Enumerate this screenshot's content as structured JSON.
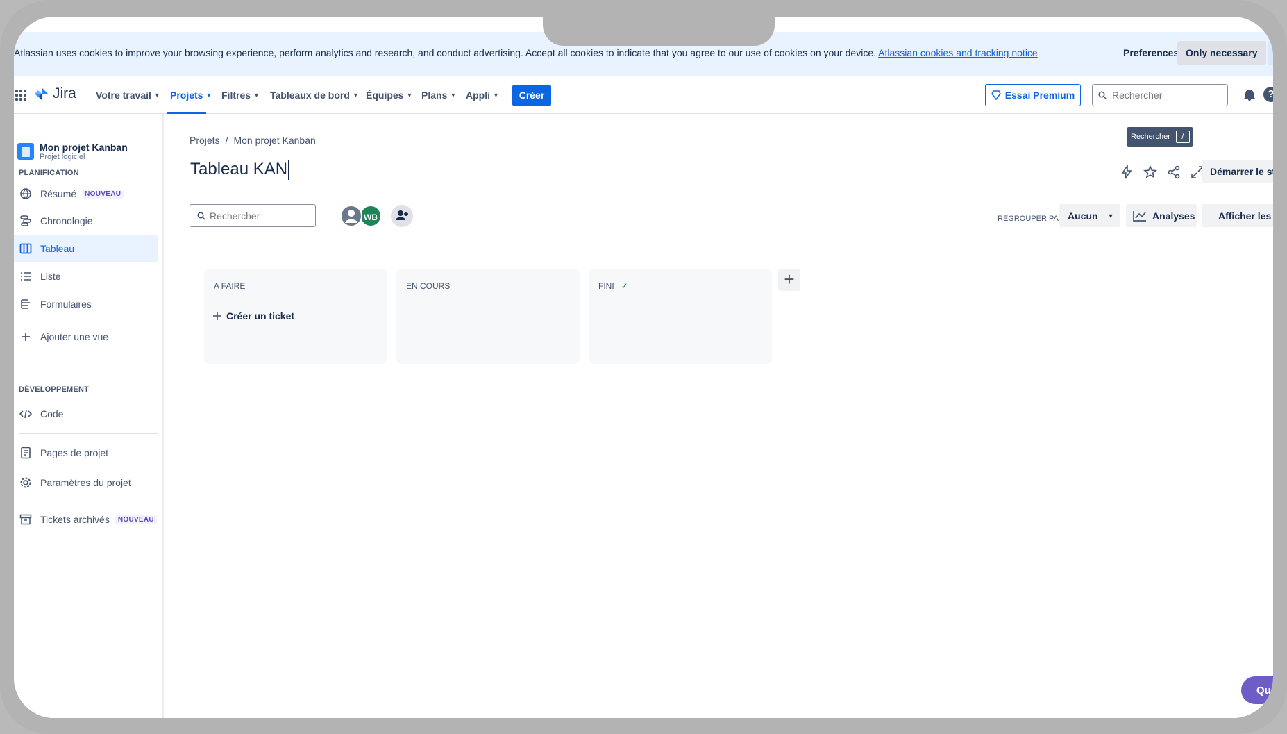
{
  "cookie_banner": {
    "message": "Atlassian uses cookies to improve your browsing experience, perform analytics and research, and conduct advertising. Accept all cookies to indicate that you agree to our use of cookies on your device.",
    "link": "Atlassian cookies and tracking notice",
    "preferences": "Preferences",
    "only_necessary": "Only necessary"
  },
  "topnav": {
    "logo": "Jira",
    "items": [
      "Votre travail",
      "Projets",
      "Filtres",
      "Tableaux de bord",
      "Équipes",
      "Plans",
      "Appli"
    ],
    "active_item": "Projets",
    "create": "Créer",
    "premium": "Essai Premium",
    "search_placeholder": "Rechercher",
    "tooltip": "Rechercher",
    "tooltip_key": "/"
  },
  "sidebar": {
    "project_name": "Mon projet Kanban",
    "project_type": "Projet logiciel",
    "planning_title": "PLANIFICATION",
    "planning_items": [
      {
        "label": "Résumé",
        "badge": "NOUVEAU",
        "icon": "globe-icon"
      },
      {
        "label": "Chronologie",
        "icon": "timeline-icon"
      },
      {
        "label": "Tableau",
        "icon": "board-icon",
        "active": true
      },
      {
        "label": "Liste",
        "icon": "list-icon"
      },
      {
        "label": "Formulaires",
        "icon": "forms-icon"
      }
    ],
    "add_view": "Ajouter une vue",
    "dev_title": "DÉVELOPPEMENT",
    "code": "Code",
    "project_pages": "Pages de projet",
    "project_settings": "Paramètres du projet",
    "archived": "Tickets archivés",
    "archived_badge": "NOUVEAU"
  },
  "main": {
    "breadcrumbs": [
      "Projets",
      "/",
      "Mon projet Kanban"
    ],
    "title": "Tableau KAN",
    "standup": "Démarrer le standup",
    "search_placeholder": "Rechercher",
    "avatar_initials": "WB",
    "group_by_label": "REGROUPER PAR",
    "group_by_value": "Aucun",
    "analyses": "Analyses",
    "view_settings": "Afficher les paramètres",
    "columns": [
      {
        "title": "A FAIRE",
        "create_label": "Créer un ticket"
      },
      {
        "title": "EN COURS"
      },
      {
        "title": "FINI",
        "done": true
      }
    ]
  },
  "quickstart": "Quickstart",
  "colors": {
    "accent": "#0c66e4",
    "sidebar_active_bg": "#e9f2ff",
    "avatar_wb": "#1f845a",
    "quickstart": "#6e5dc6"
  }
}
